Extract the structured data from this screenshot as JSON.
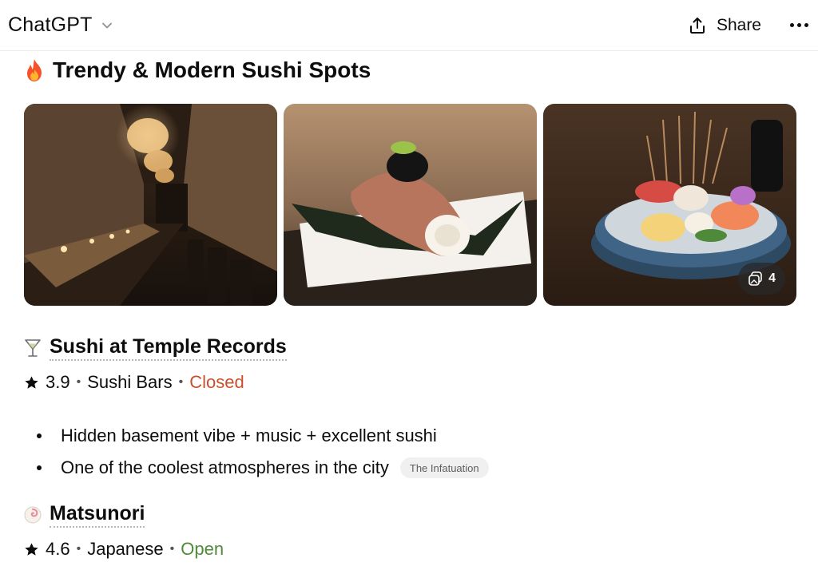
{
  "header": {
    "model_name": "ChatGPT",
    "share_label": "Share"
  },
  "section": {
    "title": "Trendy & Modern Sushi Spots",
    "icon": "fire-icon"
  },
  "gallery": {
    "images": [
      "sushi-bar-interior-photo",
      "wagyu-sushi-roll-photo",
      "sashimi-platter-photo"
    ],
    "more_count": "4"
  },
  "places": [
    {
      "name": "Sushi at Temple Records",
      "icon": "cocktail-glass-icon",
      "rating": "3.9",
      "category": "Sushi Bars",
      "status": "Closed",
      "status_color": "#c8502c",
      "highlights": [
        "Hidden basement vibe + music + excellent sushi",
        "One of the coolest atmospheres in the city"
      ],
      "source": "The Infatuation"
    },
    {
      "name": "Matsunori",
      "icon": "fish-cake-icon",
      "rating": "4.6",
      "category": "Japanese",
      "status": "Open",
      "status_color": "#4f8a3a"
    }
  ],
  "meta_separator": "•"
}
